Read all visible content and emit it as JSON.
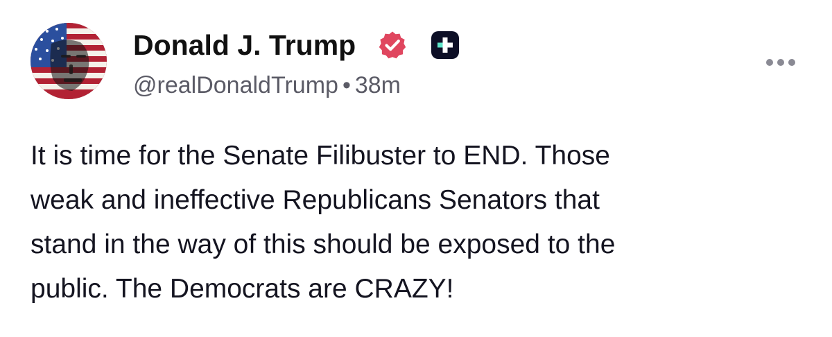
{
  "post": {
    "author": {
      "display_name": "Donald J. Trump",
      "handle": "@realDonaldTrump",
      "avatar_icon": "flag-portrait-avatar",
      "verified_icon": "verified-badge-icon",
      "verified_color": "#e0465f",
      "plus_badge_icon": "truth-plus-icon"
    },
    "separator": "•",
    "timestamp": "38m",
    "more_icon": "more-options-icon",
    "text": "It is time for the Senate Filibuster to END. Those\nweak and ineffective Republicans Senators that\nstand in the way of this should be exposed to the\npublic. The Democrats are CRAZY!"
  }
}
